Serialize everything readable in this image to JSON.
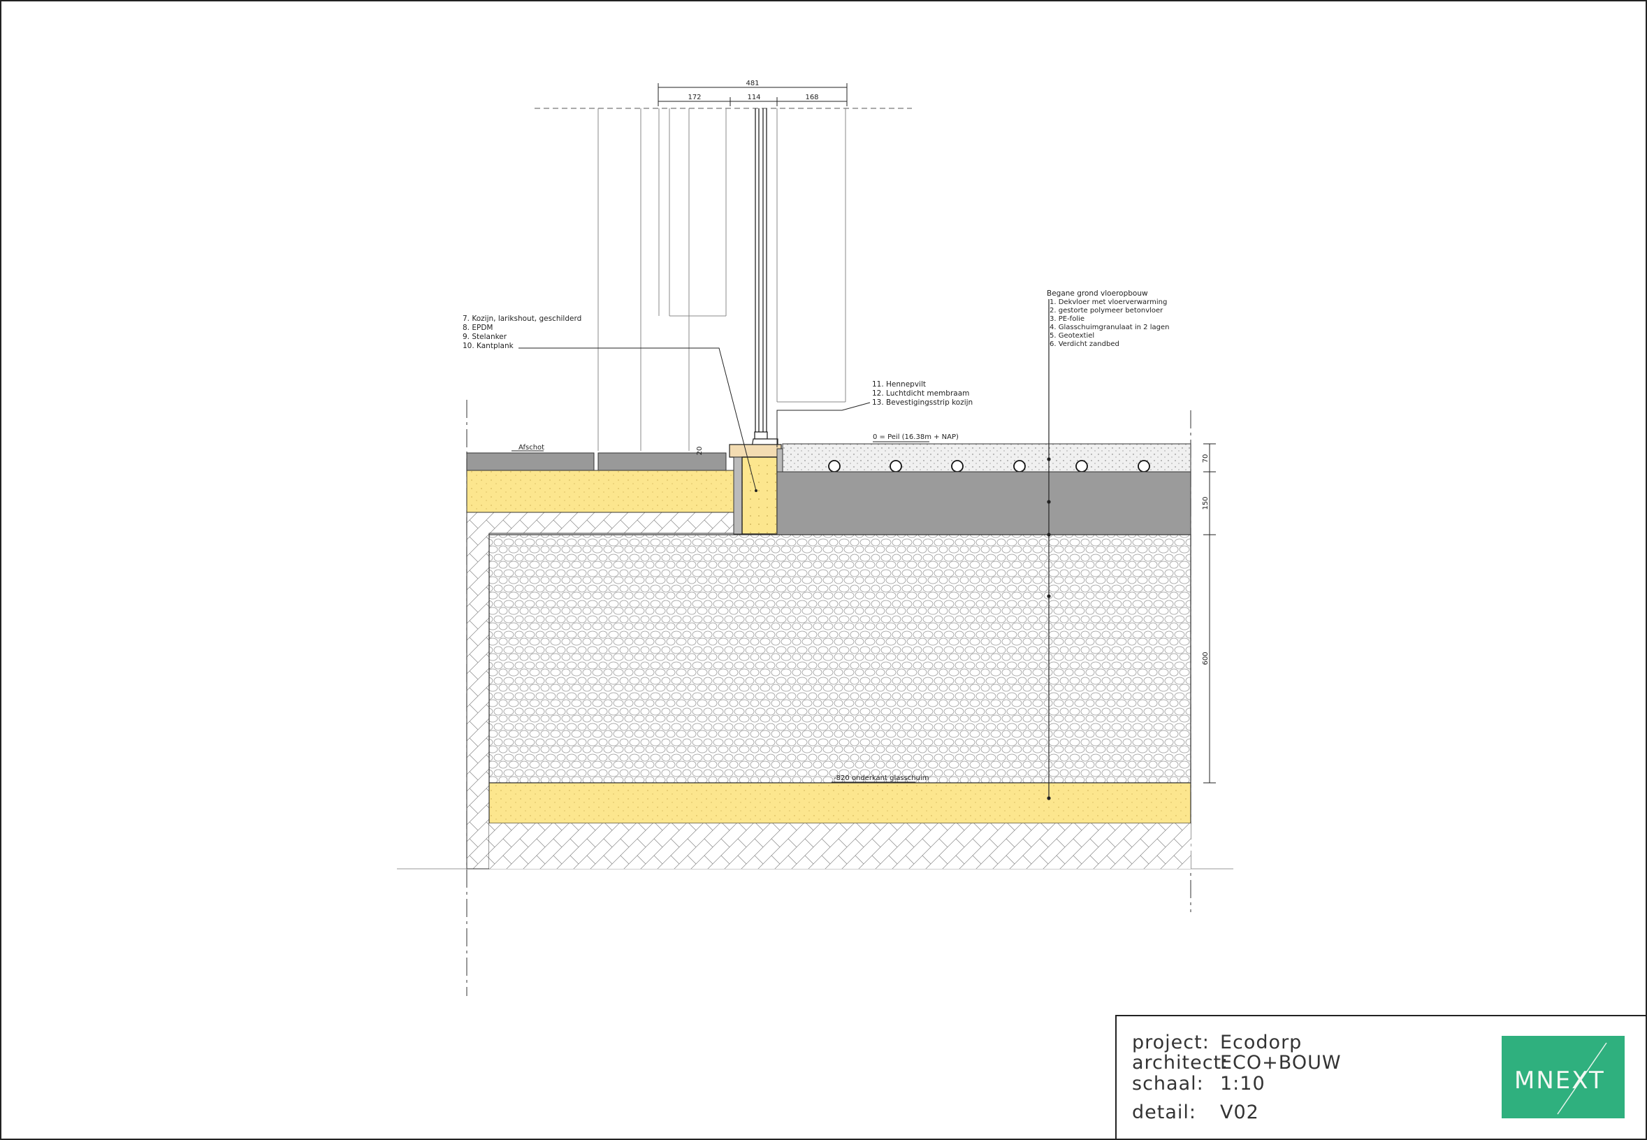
{
  "drawing": {
    "dimensions_top": {
      "overall": "481",
      "left": "172",
      "middle": "114",
      "right": "168"
    },
    "callout_left": {
      "items": [
        "7.  Kozijn, larikshout, geschilderd",
        "8.  EPDM",
        "9.  Stelanker",
        "10.  Kantplank"
      ]
    },
    "callout_mid": {
      "items": [
        "11.  Hennepvilt",
        "12.  Luchtdicht membraam",
        "13.  Bevestigingsstrip kozijn"
      ]
    },
    "floor_buildup": {
      "title": "Begane grond vloeropbouw",
      "items": [
        "1.   Dekvloer met vloerverwarming",
        "2.   gestorte polymeer betonvloer",
        "3.   PE-folie",
        "4.   Glasschuimgranulaat in 2 lagen",
        "5.   Geotextiel",
        "6.   Verdicht zandbed"
      ]
    },
    "level_label": "0 = Peil (16.38m + NAP)",
    "slope_label": "Afschot",
    "small_dim": "20",
    "bottom_label": "-820 onderkant glasschuim",
    "dims_right": [
      "70",
      "150",
      "600"
    ]
  },
  "title_block": {
    "project_label": "project:",
    "project_value": "Ecodorp",
    "architect_label": "architect:",
    "architect_value": "ECO+BOUW",
    "scale_label": "schaal:",
    "scale_value": "1:10",
    "detail_label": "detail:",
    "detail_value": "V02",
    "logo_text": "MNEXT",
    "logo_color": "#2fb07e"
  }
}
